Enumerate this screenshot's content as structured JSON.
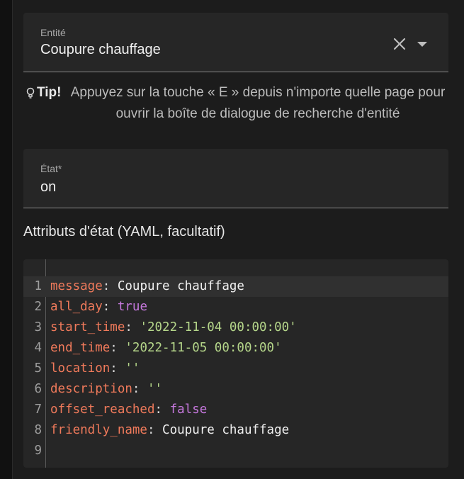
{
  "entity_field": {
    "label": "Entité",
    "value": "Coupure chauffage",
    "clear_icon": "close-icon",
    "dropdown_icon": "dropdown-arrow-icon"
  },
  "tip": {
    "icon": "lightbulb-icon",
    "strong": "Tip!",
    "text": "Appuyez sur la touche « E » depuis n'importe quelle page pour ouvrir la boîte de dialogue de recherche d'entité"
  },
  "state_field": {
    "label": "État*",
    "value": "on"
  },
  "attributes": {
    "title": "Attributs d'état (YAML, facultatif)",
    "lines": [
      {
        "num": "1",
        "key": "message",
        "sep": ": ",
        "value": "Coupure chauffage"
      },
      {
        "num": "2",
        "key": "all_day",
        "sep": ": ",
        "value": "true"
      },
      {
        "num": "3",
        "key": "start_time",
        "sep": ": ",
        "value": "'2022-11-04 00:00:00'"
      },
      {
        "num": "4",
        "key": "end_time",
        "sep": ": ",
        "value": "'2022-11-05 00:00:00'"
      },
      {
        "num": "5",
        "key": "location",
        "sep": ": ",
        "value": "''"
      },
      {
        "num": "6",
        "key": "description",
        "sep": ": ",
        "value": "''"
      },
      {
        "num": "7",
        "key": "offset_reached",
        "sep": ": ",
        "value": "false"
      },
      {
        "num": "8",
        "key": "friendly_name",
        "sep": ": ",
        "value": "Coupure chauffage"
      },
      {
        "num": "9",
        "key": "",
        "sep": "",
        "value": ""
      }
    ]
  },
  "colors": {
    "yaml_key": "#f07a5b",
    "yaml_string": "#b5d68a",
    "yaml_boolean": "#c678dd",
    "field_bg": "#262626"
  }
}
